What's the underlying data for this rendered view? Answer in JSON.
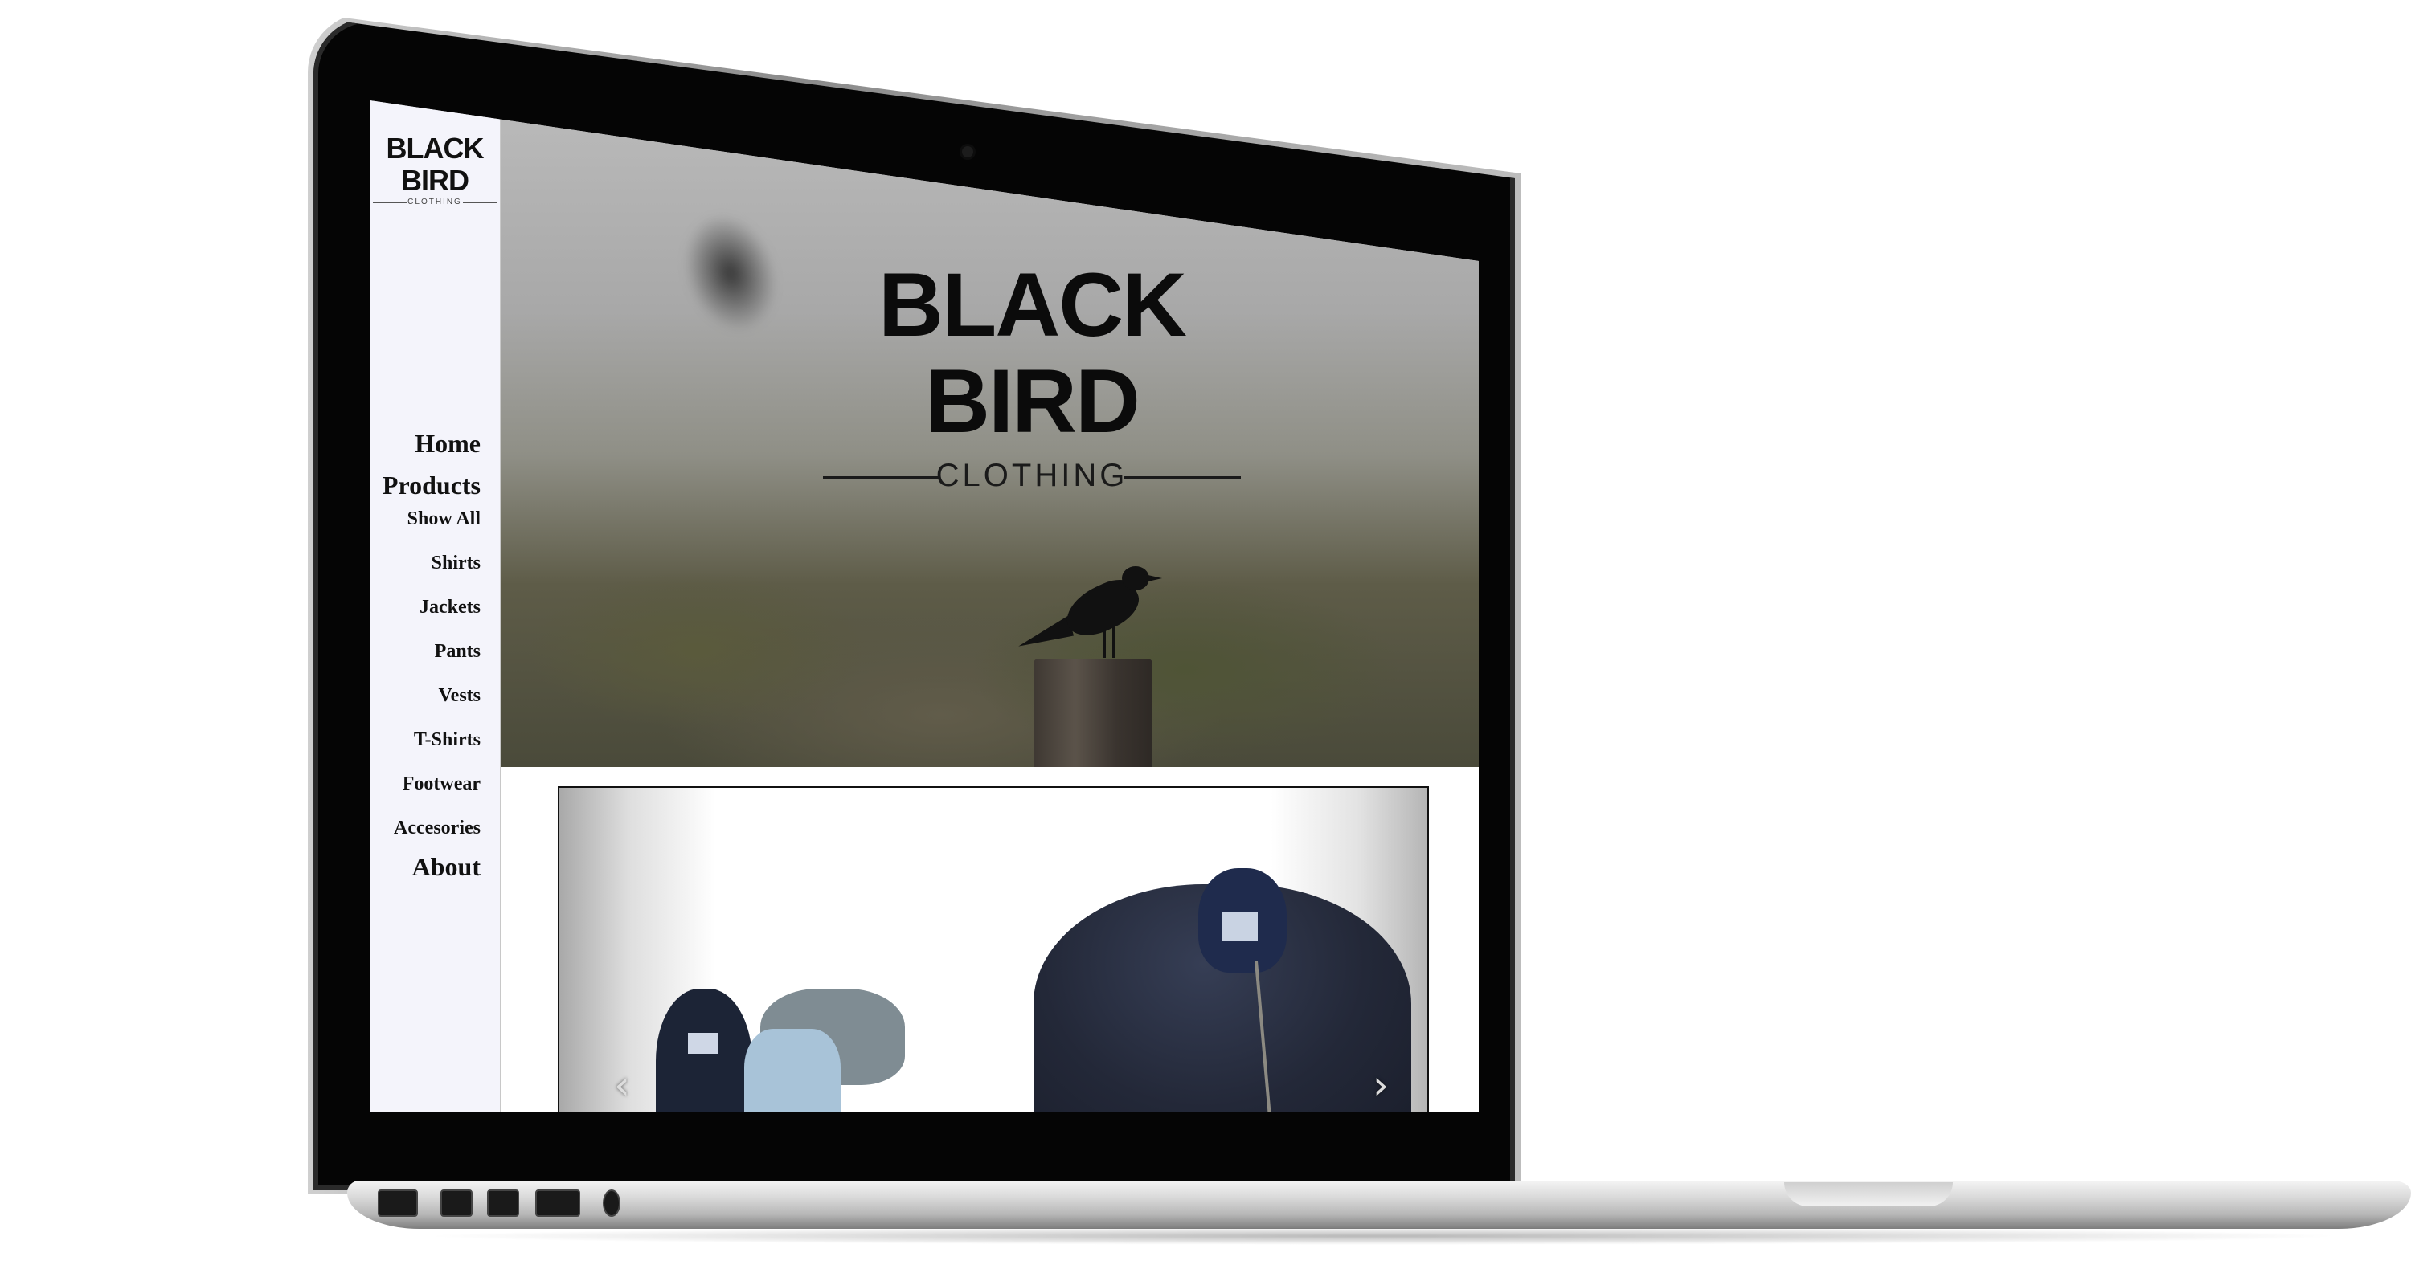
{
  "site": {
    "logo_brand": "BLACK BIRD",
    "logo_sub": "CLOTHING"
  },
  "hero": {
    "brand": "BLACK BIRD",
    "sub": "CLOTHING"
  },
  "nav": {
    "home": "Home",
    "products": "Products",
    "categories": [
      "Show All",
      "Shirts",
      "Jackets",
      "Pants",
      "Vests",
      "T-Shirts",
      "Footwear",
      "Accesories"
    ],
    "about": "About"
  },
  "slider": {
    "prev_glyph": "‹",
    "next_glyph": "›"
  },
  "colors": {
    "sidebar_bg": "#f4f4fb",
    "text": "#111111",
    "frame_dark": "#050505"
  }
}
